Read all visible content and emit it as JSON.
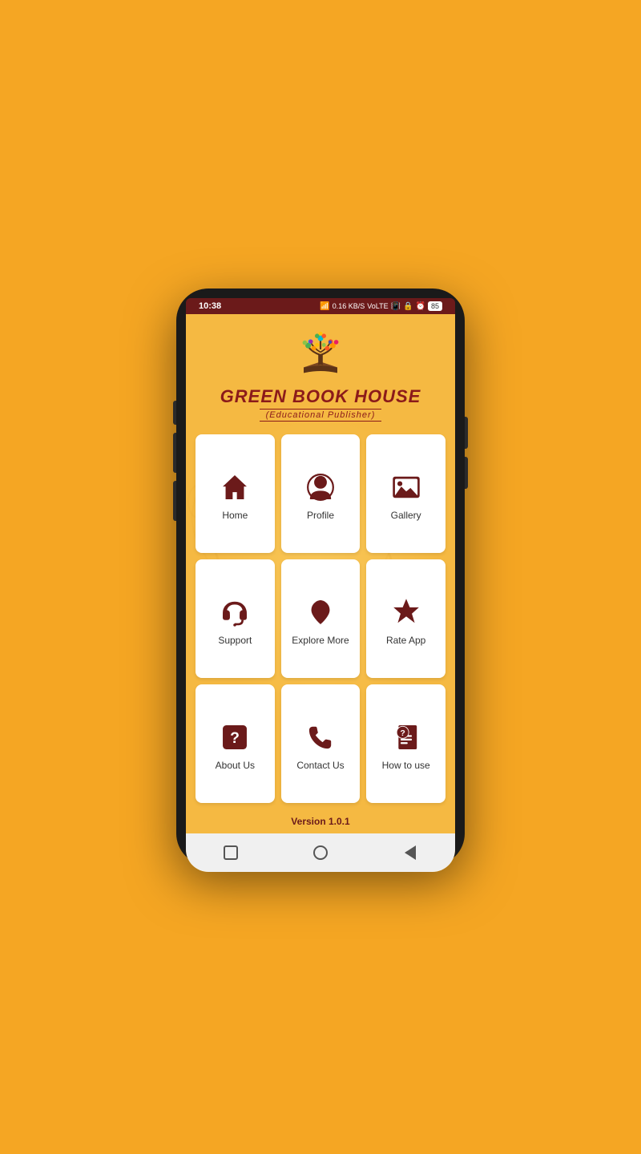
{
  "status_bar": {
    "time": "10:38",
    "signal": "4G",
    "battery": "85"
  },
  "app": {
    "title": "GREEN BOOK HOUSE",
    "subtitle": "(Educational Publisher)",
    "version": "Version 1.0.1"
  },
  "menu_items": [
    {
      "id": "home",
      "label": "Home",
      "icon": "home"
    },
    {
      "id": "profile",
      "label": "Profile",
      "icon": "profile"
    },
    {
      "id": "gallery",
      "label": "Gallery",
      "icon": "gallery"
    },
    {
      "id": "support",
      "label": "Support",
      "icon": "support"
    },
    {
      "id": "explore",
      "label": "Explore More",
      "icon": "heart"
    },
    {
      "id": "rate",
      "label": "Rate App",
      "icon": "star"
    },
    {
      "id": "about",
      "label": "About Us",
      "icon": "question-box"
    },
    {
      "id": "contact",
      "label": "Contact Us",
      "icon": "phone"
    },
    {
      "id": "howto",
      "label": "How to use",
      "icon": "how-to"
    }
  ],
  "colors": {
    "primary": "#6B1A1A",
    "background": "#F5B942",
    "card_bg": "#FFFFFF",
    "accent": "#F5A623"
  }
}
